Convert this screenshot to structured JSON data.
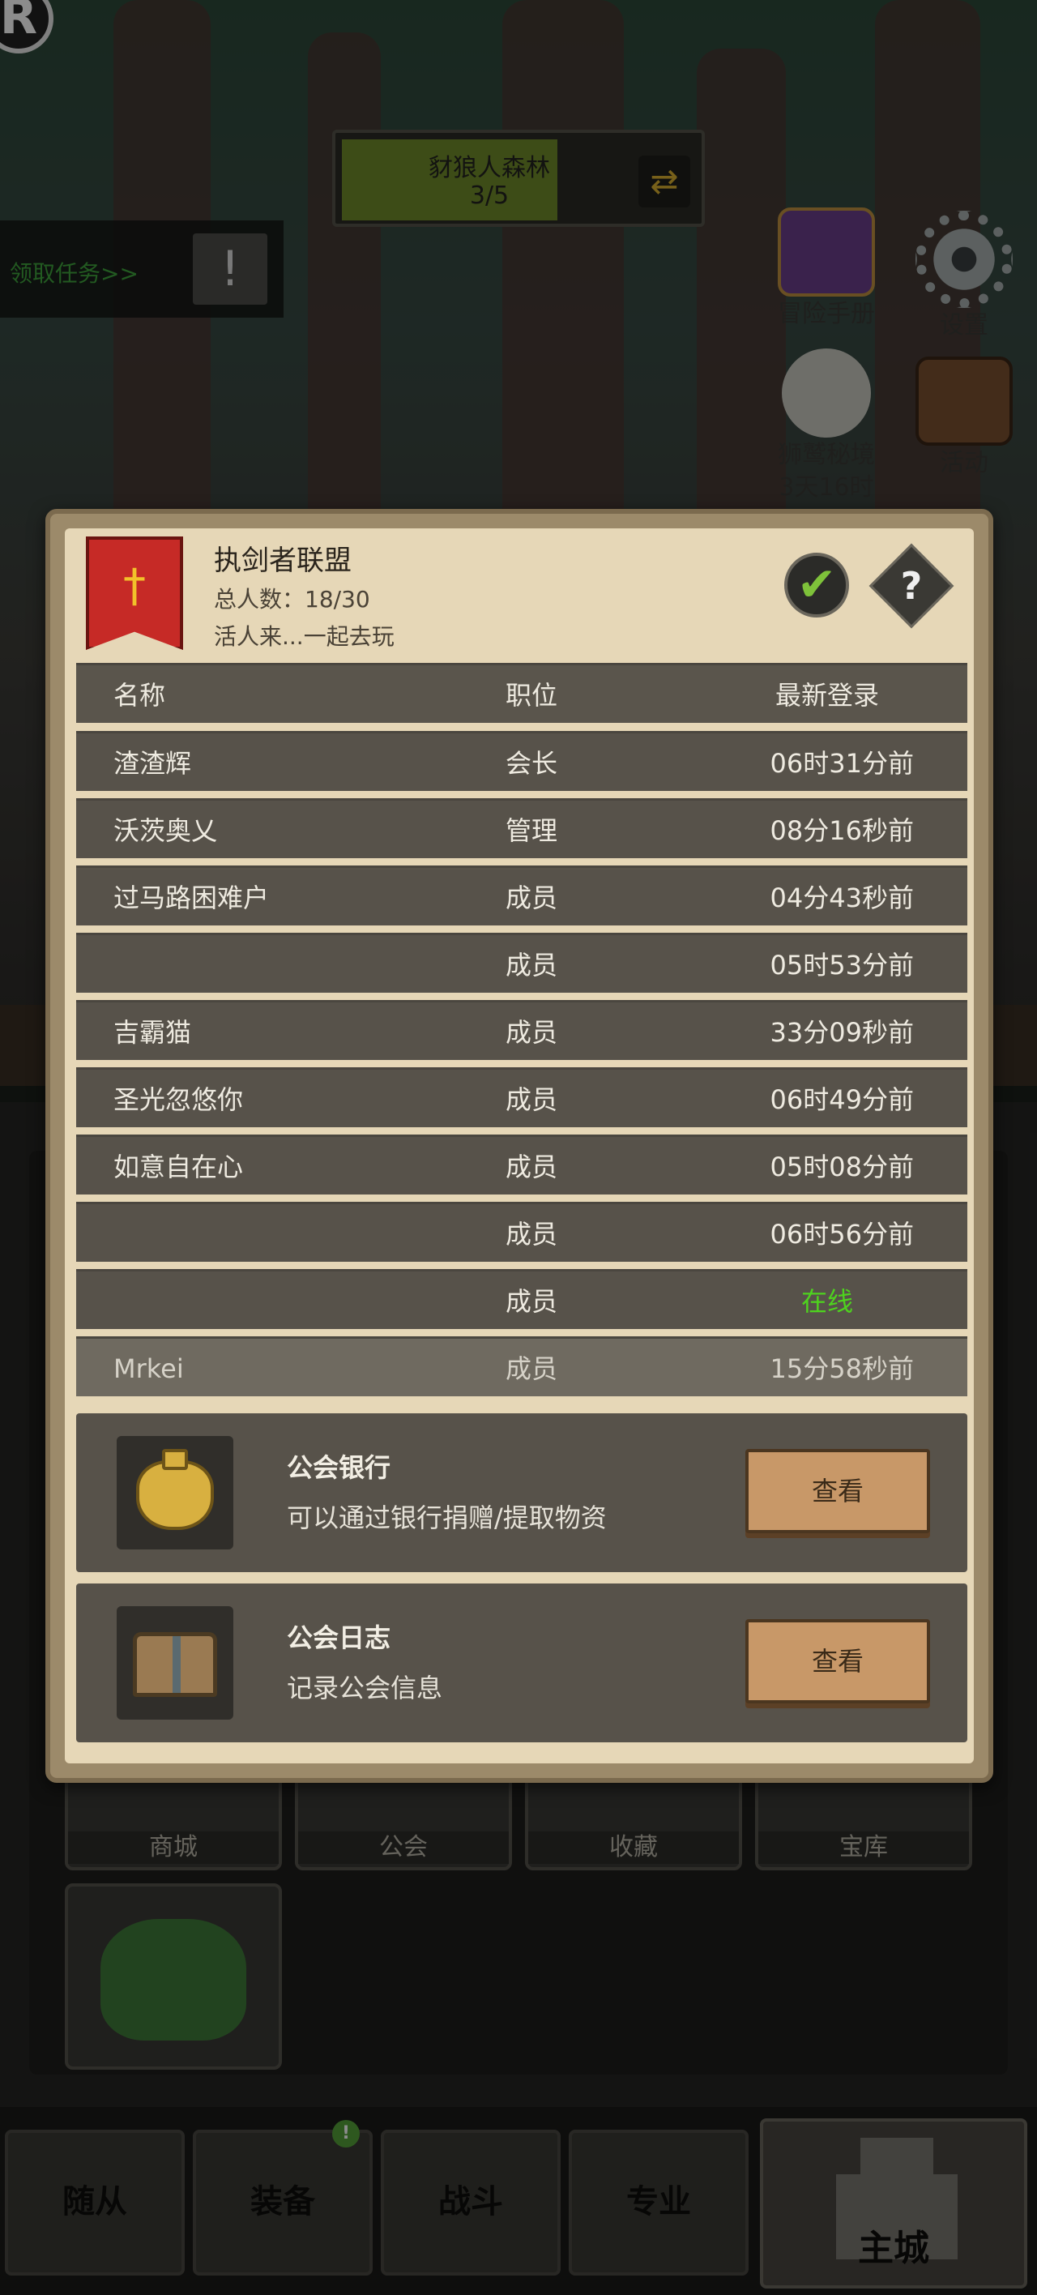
{
  "hud": {
    "badge": "R",
    "area_name": "豺狼人森林",
    "area_count": "3/5",
    "area_progress": 0.6,
    "quest_label": "领取任务>>",
    "quest_icon": "!",
    "icons": [
      {
        "label": "冒险手册",
        "icon": "book-icon"
      },
      {
        "label": "设置",
        "icon": "gear-icon"
      },
      {
        "label": "狮鹫秘境",
        "sub": "3天16时",
        "icon": "griffin-icon"
      },
      {
        "label": "活动",
        "icon": "notice-board-icon"
      }
    ]
  },
  "dialog": {
    "guild_name": "执剑者联盟",
    "member_count": "总人数：18/30",
    "motto": "活人来...一起去玩",
    "check_symbol": "✔",
    "help_symbol": "?",
    "columns": [
      "名称",
      "职位",
      "最新登录"
    ],
    "members": [
      {
        "name": "渣渣辉",
        "role": "会长",
        "last_login": "06时31分前",
        "online": false
      },
      {
        "name": "沃茨奥乂",
        "role": "管理",
        "last_login": "08分16秒前",
        "online": false
      },
      {
        "name": "过马路困难户",
        "role": "成员",
        "last_login": "04分43秒前",
        "online": false
      },
      {
        "name": "",
        "role": "成员",
        "last_login": "05时53分前",
        "online": false
      },
      {
        "name": "吉霸猫",
        "role": "成员",
        "last_login": "33分09秒前",
        "online": false
      },
      {
        "name": "圣光忽悠你",
        "role": "成员",
        "last_login": "06时49分前",
        "online": false
      },
      {
        "name": "如意自在心",
        "role": "成员",
        "last_login": "05时08分前",
        "online": false
      },
      {
        "name": "",
        "role": "成员",
        "last_login": "06时56分前",
        "online": false
      },
      {
        "name": "",
        "role": "成员",
        "last_login": "在线",
        "online": true
      },
      {
        "name": "Mrkei",
        "role": "成员",
        "last_login": "15分58秒前",
        "online": false
      }
    ],
    "bank": {
      "title": "公会银行",
      "desc": "可以通过银行捐赠/提取物资",
      "button": "查看"
    },
    "log": {
      "title": "公会日志",
      "desc": "记录公会信息",
      "button": "查看"
    },
    "colors": {
      "online": "#4ed31e",
      "banner": "#c62a26",
      "check": "#7ec23a"
    }
  },
  "menu": {
    "tiles": [
      "商城",
      "公会",
      "收藏",
      "宝库"
    ]
  },
  "bottom_nav": {
    "items": [
      "随从",
      "装备",
      "战斗",
      "专业"
    ],
    "main": "主城",
    "badge": "!"
  }
}
